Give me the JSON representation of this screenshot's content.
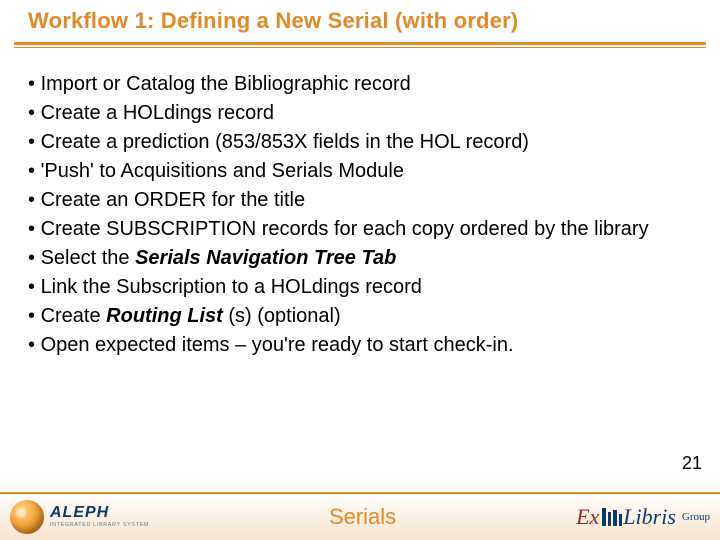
{
  "title": "Workflow 1: Defining a New Serial (with order)",
  "bullets": {
    "b0": "Import or Catalog the Bibliographic record",
    "b1": "Create a HOLdings record",
    "b2": "Create a prediction (853/853X fields in the HOL record)",
    "b3": "'Push' to Acquisitions and Serials Module",
    "b4": "Create an ORDER for the title",
    "b5": "Create SUBSCRIPTION records for each copy ordered by the library",
    "b6_pre": "Select the ",
    "b6_em": "Serials Navigation Tree Tab",
    "b7": "Link the Subscription to a HOLdings record",
    "b8_pre": "Create ",
    "b8_em": "Routing List",
    "b8_post": " (s) (optional)",
    "b9": "Open expected items – you're ready to start check-in."
  },
  "marker": "• ",
  "page_number": "21",
  "footer": {
    "center": "Serials",
    "aleph_brand": "ALEPH",
    "aleph_tag": "INTEGRATED LIBRARY SYSTEM",
    "exlibris_ex": "Ex",
    "exlibris_libris": "Libris",
    "exlibris_group": "Group"
  }
}
